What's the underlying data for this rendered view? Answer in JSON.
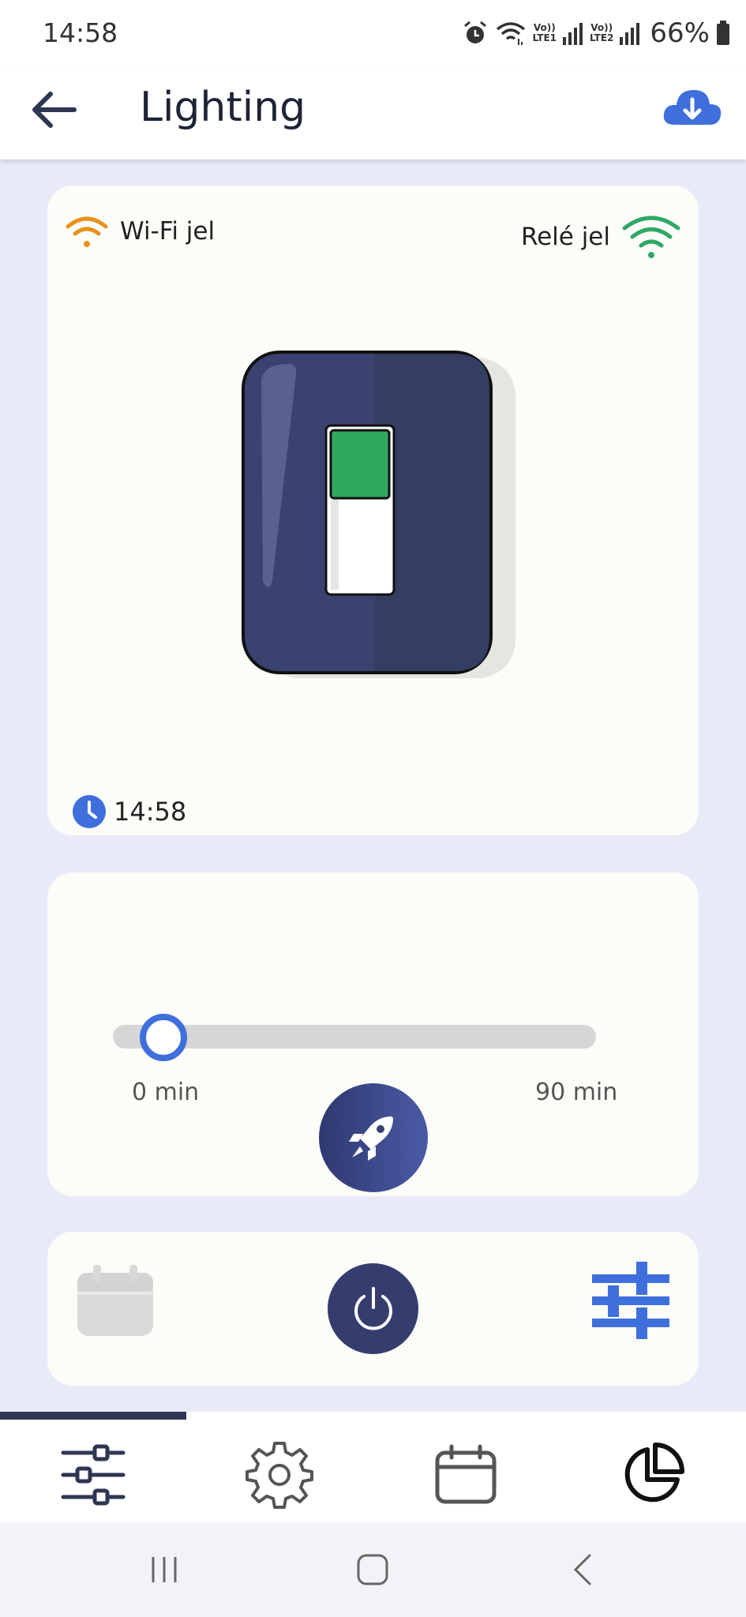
{
  "status_bar": {
    "time": "14:58",
    "lte1": "LTE1",
    "lte2": "LTE2",
    "battery": "66%",
    "icons": [
      "alarm-icon",
      "wifi-icon",
      "volte-icon",
      "signal-icon",
      "battery-icon"
    ]
  },
  "header": {
    "title": "Lighting",
    "back_icon": "arrow-left-icon",
    "action_icon": "cloud-download-icon"
  },
  "device": {
    "wifi_label": "Wi-Fi jel",
    "relay_label": "Relé jel",
    "switch_state": "on",
    "time": "14:58",
    "colors": {
      "wifi": "#e8921c",
      "relay": "#2fa866",
      "switch_on": "#30a95e",
      "switch_body": "#3a4270"
    }
  },
  "timer": {
    "min_label": "0 min",
    "max_label": "90 min",
    "value_min": 0,
    "boost_icon": "rocket-icon"
  },
  "controls": {
    "calendar_icon": "calendar-icon",
    "power_icon": "power-icon",
    "settings_icon": "sliders-icon"
  },
  "bottom_nav": {
    "items": [
      "sliders-icon",
      "gear-icon",
      "calendar-icon",
      "pie-chart-icon"
    ],
    "active_index": 0
  },
  "system_nav": [
    "recents-icon",
    "home-icon",
    "back-icon"
  ]
}
